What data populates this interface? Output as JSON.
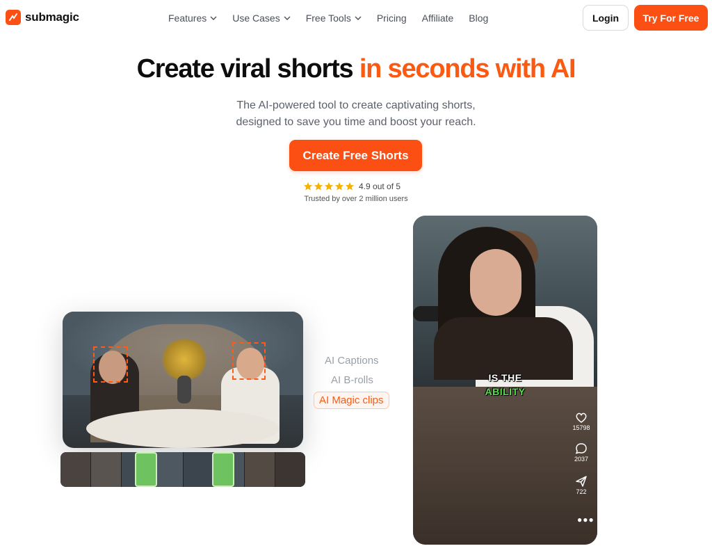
{
  "brand": {
    "name": "submagic",
    "color": "#fb4f14"
  },
  "nav": {
    "items": [
      {
        "label": "Features",
        "has_dropdown": true
      },
      {
        "label": "Use Cases",
        "has_dropdown": true
      },
      {
        "label": "Free Tools",
        "has_dropdown": true
      },
      {
        "label": "Pricing",
        "has_dropdown": false
      },
      {
        "label": "Affiliate",
        "has_dropdown": false
      },
      {
        "label": "Blog",
        "has_dropdown": false
      }
    ],
    "login_label": "Login",
    "try_label": "Try For Free"
  },
  "hero": {
    "headline_main": "Create viral shorts",
    "headline_accent": "in seconds with AI",
    "subtitle_line1": "The AI-powered tool to create captivating shorts,",
    "subtitle_line2": "designed to save you time and boost your reach.",
    "cta_label": "Create Free Shorts",
    "rating_text": "4.9 out of 5",
    "stars": 5,
    "trusted_text": "Trusted by over 2 million users"
  },
  "features": [
    {
      "label": "AI Captions",
      "active": false
    },
    {
      "label": "AI B-rolls",
      "active": false
    },
    {
      "label": "AI Magic clips",
      "active": true
    }
  ],
  "phone": {
    "caption_line1": "IS THE",
    "caption_line2": "ABILITY",
    "likes": "15798",
    "comments": "2037",
    "shares": "722"
  }
}
